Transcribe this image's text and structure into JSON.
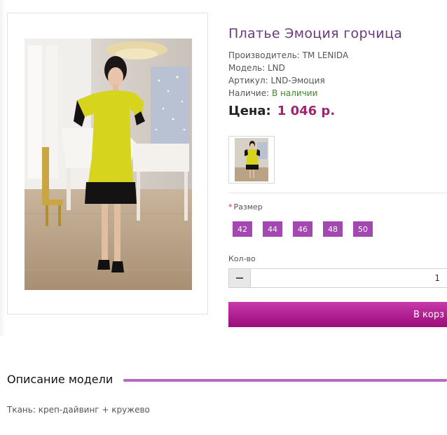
{
  "product": {
    "title": "Платье Эмоция горчица",
    "manufacturer": "Производитель: ТМ LENIDA",
    "model": "Модель: LND",
    "sku": "Артикул: LND-Эмоция",
    "availability_label": "Наличие:",
    "availability_value": "В наличии",
    "price_label": "Цена:",
    "price_value": "1 046 р."
  },
  "options": {
    "size_label": "Размер",
    "required_mark": "*",
    "sizes": [
      "42",
      "44",
      "46",
      "48",
      "50"
    ]
  },
  "quantity": {
    "label": "Кол-во",
    "value": "1"
  },
  "cart_button_label": "В корз",
  "description": {
    "heading": "Описание модели",
    "fabric": "Ткань: креп-дайвинг + кружево"
  },
  "colors": {
    "accent": "#a248b0",
    "title": "#6b3a7d",
    "price": "#a0246f",
    "in_stock": "#3c8a1f",
    "dress": "#d6d41c",
    "lace": "#111111"
  },
  "icons": {
    "minus": "minus-icon"
  }
}
